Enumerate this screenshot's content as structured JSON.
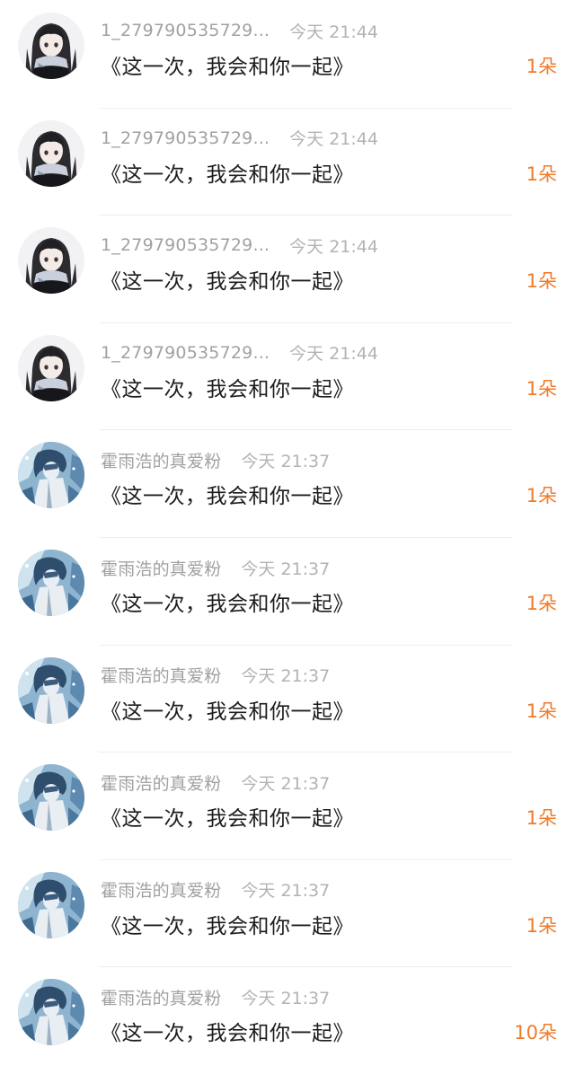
{
  "accent_color": "#f07a2a",
  "items": [
    {
      "user": "1_279790535729...",
      "time": "今天 21:44",
      "message": "《这一次，我会和你一起》",
      "gift": "1朵",
      "avatar": "dark-hair-girl-avatar"
    },
    {
      "user": "1_279790535729...",
      "time": "今天 21:44",
      "message": "《这一次，我会和你一起》",
      "gift": "1朵",
      "avatar": "dark-hair-girl-avatar"
    },
    {
      "user": "1_279790535729...",
      "time": "今天 21:44",
      "message": "《这一次，我会和你一起》",
      "gift": "1朵",
      "avatar": "dark-hair-girl-avatar"
    },
    {
      "user": "1_279790535729...",
      "time": "今天 21:44",
      "message": "《这一次，我会和你一起》",
      "gift": "1朵",
      "avatar": "dark-hair-girl-avatar"
    },
    {
      "user": "霍雨浩的真爱粉",
      "time": "今天 21:37",
      "message": "《这一次，我会和你一起》",
      "gift": "1朵",
      "avatar": "blue-anime-avatar"
    },
    {
      "user": "霍雨浩的真爱粉",
      "time": "今天 21:37",
      "message": "《这一次，我会和你一起》",
      "gift": "1朵",
      "avatar": "blue-anime-avatar"
    },
    {
      "user": "霍雨浩的真爱粉",
      "time": "今天 21:37",
      "message": "《这一次，我会和你一起》",
      "gift": "1朵",
      "avatar": "blue-anime-avatar"
    },
    {
      "user": "霍雨浩的真爱粉",
      "time": "今天 21:37",
      "message": "《这一次，我会和你一起》",
      "gift": "1朵",
      "avatar": "blue-anime-avatar"
    },
    {
      "user": "霍雨浩的真爱粉",
      "time": "今天 21:37",
      "message": "《这一次，我会和你一起》",
      "gift": "1朵",
      "avatar": "blue-anime-avatar"
    },
    {
      "user": "霍雨浩的真爱粉",
      "time": "今天 21:37",
      "message": "《这一次，我会和你一起》",
      "gift": "10朵",
      "avatar": "blue-anime-avatar"
    }
  ]
}
